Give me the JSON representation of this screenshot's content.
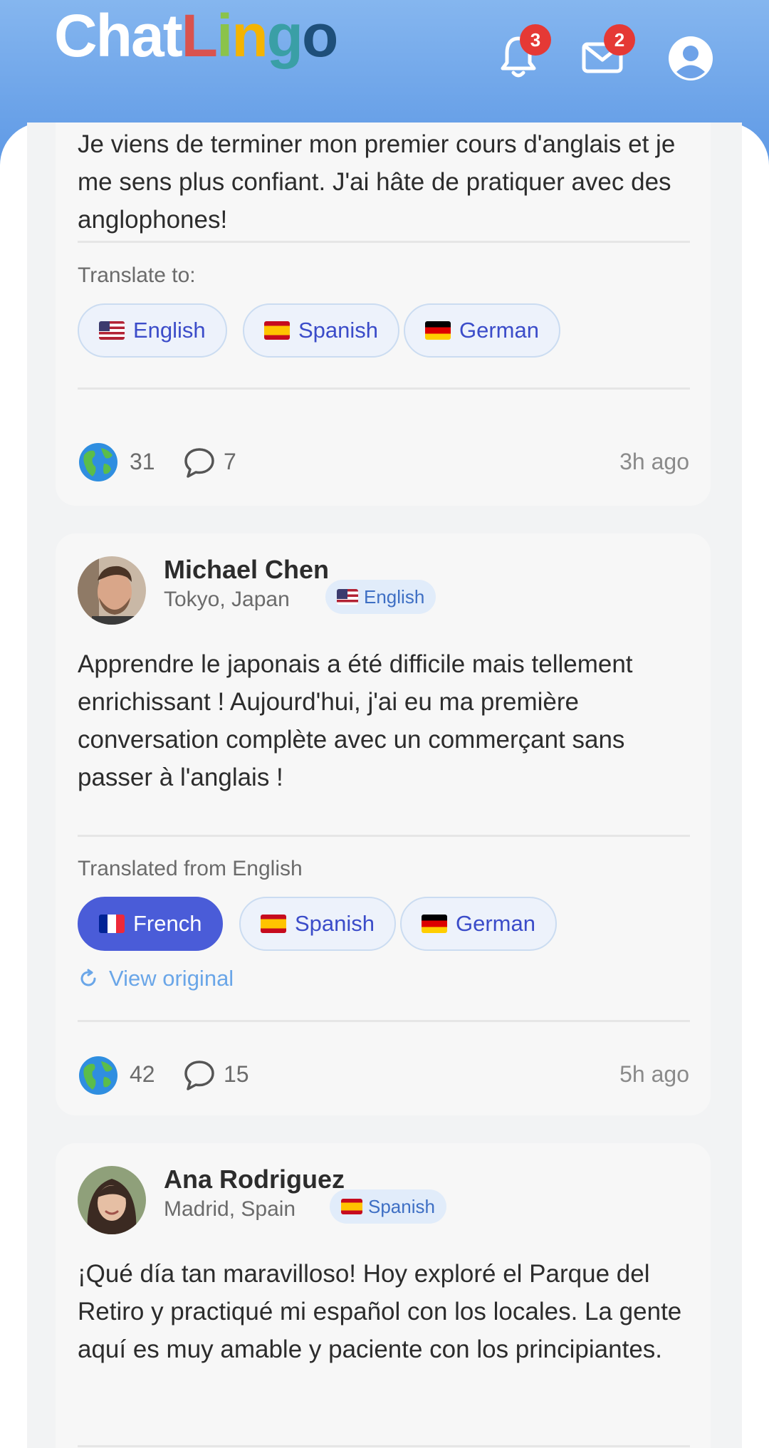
{
  "app": {
    "logo_parts": [
      {
        "text": "Chat",
        "color": "#ffffff"
      },
      {
        "text": "L",
        "color": "#d9534f"
      },
      {
        "text": "i",
        "color": "#8bc34a"
      },
      {
        "text": "n",
        "color": "#f4b400"
      },
      {
        "text": "g",
        "color": "#3a9fa6"
      },
      {
        "text": "o",
        "color": "#1e4f7a"
      }
    ],
    "notifications_count": "3",
    "messages_count": "2"
  },
  "posts": [
    {
      "text": "Je viens de terminer mon premier cours d'anglais et je me sens plus confiant. J'ai hâte de pratiquer avec des anglophones!",
      "translate_label": "Translate to:",
      "chips": [
        {
          "flag": "us",
          "label": "English",
          "active": false
        },
        {
          "flag": "es",
          "label": "Spanish",
          "active": false
        },
        {
          "flag": "de",
          "label": "German",
          "active": false
        }
      ],
      "reactions": "31",
      "comments": "7",
      "time": "3h ago"
    },
    {
      "author": "Michael Chen",
      "location": "Tokyo, Japan",
      "language": "English",
      "language_flag": "us",
      "text": "Apprendre le japonais a été difficile mais tellement enrichissant ! Aujourd'hui, j'ai eu ma première conversation complète avec un commerçant sans passer à l'anglais !",
      "translate_label": "Translated from English",
      "chips": [
        {
          "flag": "fr",
          "label": "French",
          "active": true
        },
        {
          "flag": "es",
          "label": "Spanish",
          "active": false
        },
        {
          "flag": "de",
          "label": "German",
          "active": false
        }
      ],
      "view_original": "View original",
      "reactions": "42",
      "comments": "15",
      "time": "5h ago"
    },
    {
      "author": "Ana Rodriguez",
      "location": "Madrid, Spain",
      "language": "Spanish",
      "language_flag": "es",
      "text": "¡Qué día tan maravilloso! Hoy exploré el Parque del Retiro y practiqué mi español con los locales. La gente aquí es muy amable y paciente con los principiantes."
    }
  ]
}
